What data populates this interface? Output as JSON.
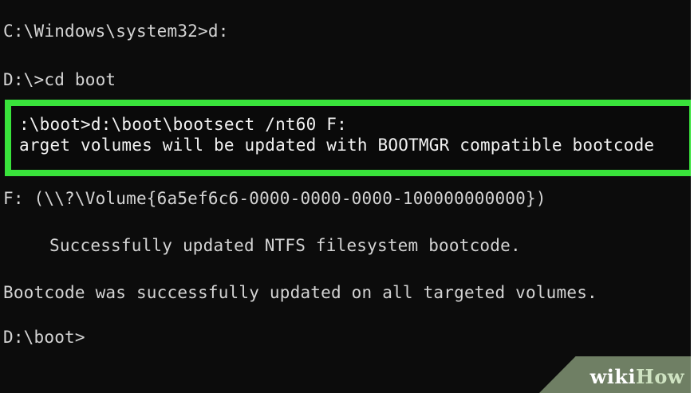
{
  "terminal": {
    "lines": {
      "l1": "C:\\Windows\\system32>d:",
      "l2": "D:\\>cd boot",
      "highlighted_1": ":\\boot>d:\\boot\\bootsect /nt60 F:",
      "highlighted_2": "arget volumes will be updated with BOOTMGR compatible bootcode",
      "l5": "F: (\\\\?\\Volume{6a5ef6c6-0000-0000-0000-100000000000})",
      "l6": "Successfully updated NTFS filesystem bootcode.",
      "l7": "Bootcode was successfully updated on all targeted volumes.",
      "l8": "D:\\boot>"
    }
  },
  "watermark": {
    "part1": "wiki",
    "part2": "How"
  },
  "colors": {
    "background": "#0c0c0c",
    "text": "#d4d4d4",
    "highlight_border": "#39e33b",
    "watermark_bg": "#6f7f64"
  }
}
